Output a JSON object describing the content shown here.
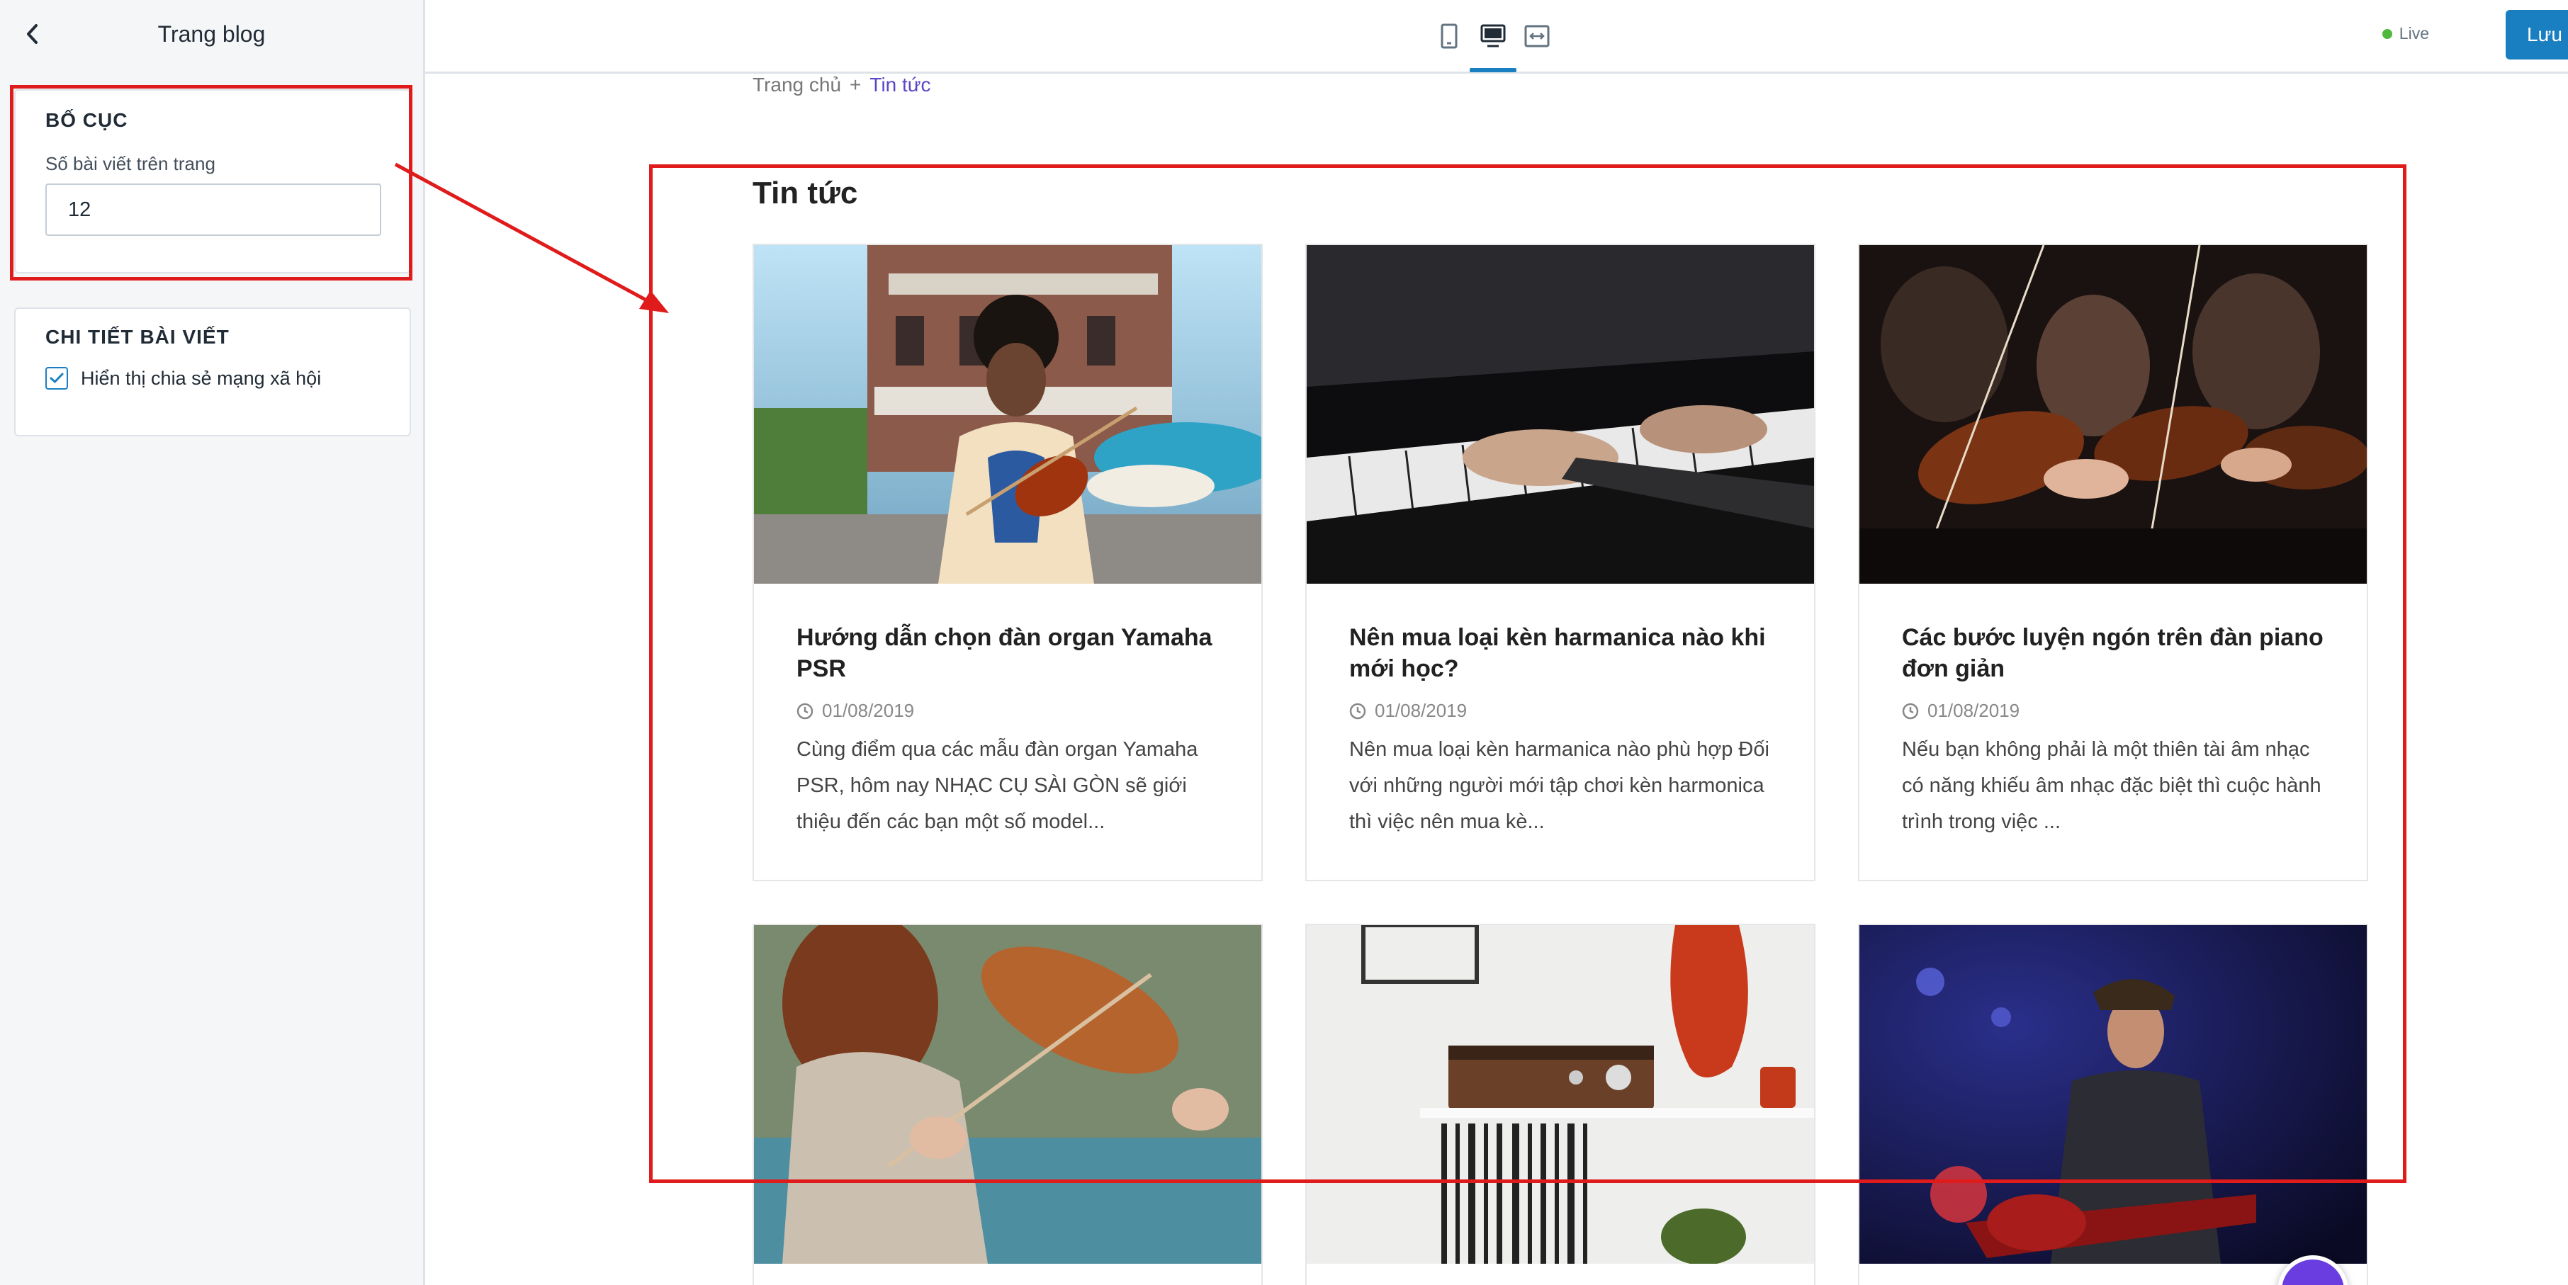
{
  "sidebar": {
    "title": "Trang blog",
    "layout_section": {
      "heading": "BỐ CỤC",
      "posts_per_page_label": "Số bài viết trên trang",
      "posts_per_page_value": "12"
    },
    "detail_section": {
      "heading": "CHI TIẾT BÀI VIẾT",
      "share_label": "Hiển thị chia sẻ mạng xã hội",
      "share_checked": true
    }
  },
  "toolbar": {
    "devices": [
      "mobile-icon",
      "desktop-icon",
      "fullwidth-icon"
    ],
    "active_device": "desktop-icon",
    "live_label": "Live",
    "save_label": "Lưu"
  },
  "preview": {
    "breadcrumb": {
      "home": "Trang chủ",
      "separator": "+",
      "current": "Tin tức"
    },
    "blog_title": "Tin tức",
    "posts": [
      {
        "title": "Hướng dẫn chọn đàn organ Yamaha PSR",
        "date": "01/08/2019",
        "excerpt": "Cùng điểm qua các mẫu đàn organ Yamaha PSR, hôm nay NHẠC CỤ SÀI GÒN sẽ giới thiệu đến các bạn một số model..."
      },
      {
        "title": "Nên mua loại kèn harmanica nào khi mới học?",
        "date": "01/08/2019",
        "excerpt": "Nên mua loại kèn harmanica nào phù hợp Đối với những người mới tập chơi kèn harmonica thì việc nên mua kè..."
      },
      {
        "title": "Các bước luyện ngón trên đàn piano đơn giản",
        "date": "01/08/2019",
        "excerpt": "Nếu bạn không phải là một thiên tài âm nhạc có năng khiếu âm nhạc đặc biệt thì cuộc hành trình trong việc ..."
      }
    ]
  },
  "colors": {
    "accent": "#1a7fc1",
    "breadcrumb_current": "#5b46c8",
    "annotation": "#e01b1b",
    "live_dot": "#50b83c"
  }
}
